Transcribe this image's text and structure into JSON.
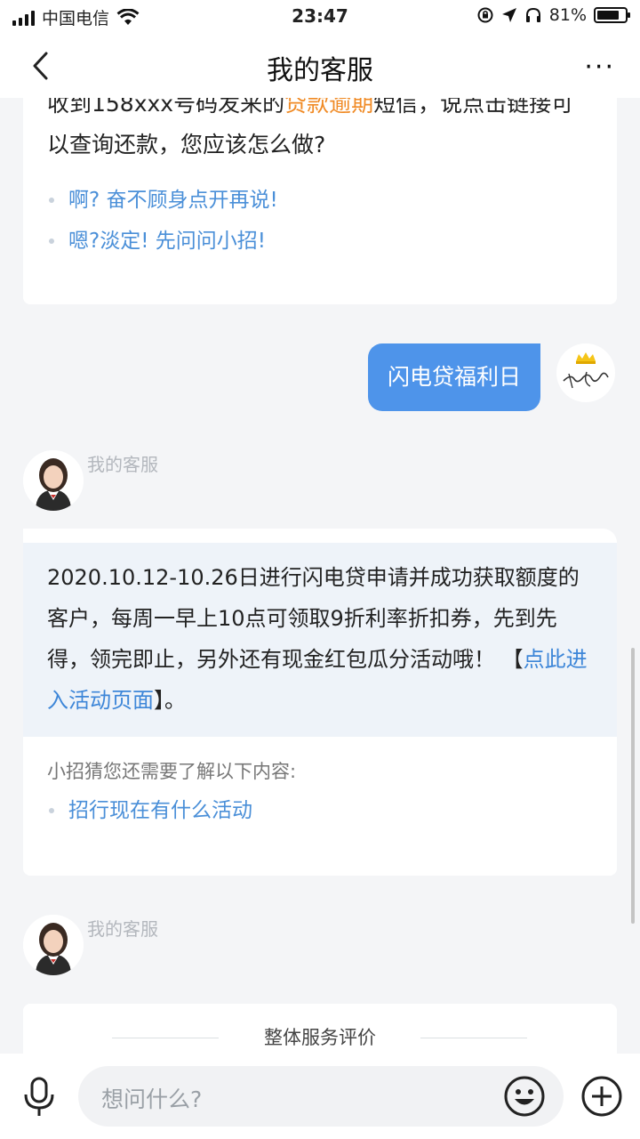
{
  "status_bar": {
    "carrier": "中国电信",
    "time": "23:47",
    "battery": "81%",
    "battery_level": 0.81
  },
  "header": {
    "title": "我的客服",
    "more": "···"
  },
  "chat": {
    "question_card": {
      "text_before": "收到158xxx号码发来的",
      "highlight": "贷款逾期",
      "text_after": "短信，说点击链接可以查询还款，您应该怎么做?",
      "options": [
        "啊? 奋不顾身点开再说!",
        "嗯?淡定! 先问问小招!"
      ]
    },
    "user_message": "闪电贷福利日",
    "agent_name": "我的客服",
    "answer_card": {
      "text": "2020.10.12-10.26日进行闪电贷申请并成功获取额度的客户，每周一早上10点可领取9折利率折扣券，先到先得，领完即止，另外还有现金红包瓜分活动哦！ 【",
      "link": "点此进入活动页面",
      "text_end": "】。",
      "suggest_title": "小招猜您还需要了解以下内容:",
      "suggestions": [
        "招行现在有什么活动"
      ]
    },
    "agent_name_2": "我的客服",
    "rating_title": "整体服务评价"
  },
  "input": {
    "placeholder": "想问什么?"
  },
  "icons": {
    "back": "chevron-left-icon",
    "mic": "microphone-icon",
    "emoji": "smiley-icon",
    "plus": "plus-circle-icon"
  }
}
